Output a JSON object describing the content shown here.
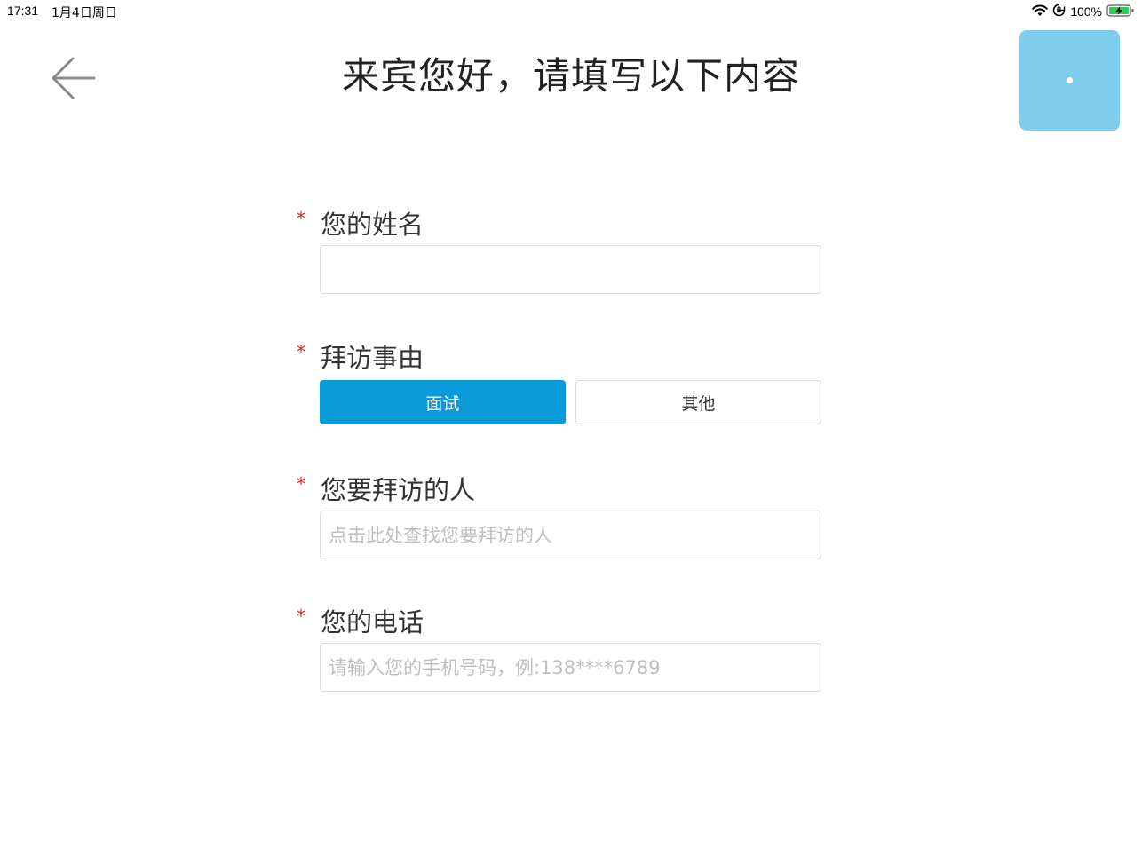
{
  "status_bar": {
    "time": "17:31",
    "date": "1月4日周日",
    "battery_percent": "100%",
    "icons": [
      "wifi-icon",
      "orientation-lock-icon",
      "battery-charging-icon"
    ]
  },
  "header": {
    "back_icon": "arrow-left-icon",
    "title": "来宾您好，请填写以下内容",
    "corner_button_color": "#7ecdec"
  },
  "form": {
    "required_mark": "*",
    "name_field": {
      "label": "您的姓名",
      "value": "",
      "placeholder": ""
    },
    "reason_field": {
      "label": "拜访事由",
      "options": [
        "面试",
        "其他"
      ],
      "selected": "面试"
    },
    "host_field": {
      "label": "您要拜访的人",
      "value": "",
      "placeholder": "点击此处查找您要拜访的人"
    },
    "phone_field": {
      "label": "您的电话",
      "value": "",
      "placeholder": "请输入您的手机号码，例:138****6789"
    }
  },
  "colors": {
    "accent": "#0a9ad8",
    "required": "#e02020",
    "placeholder": "#bfbfbf"
  }
}
